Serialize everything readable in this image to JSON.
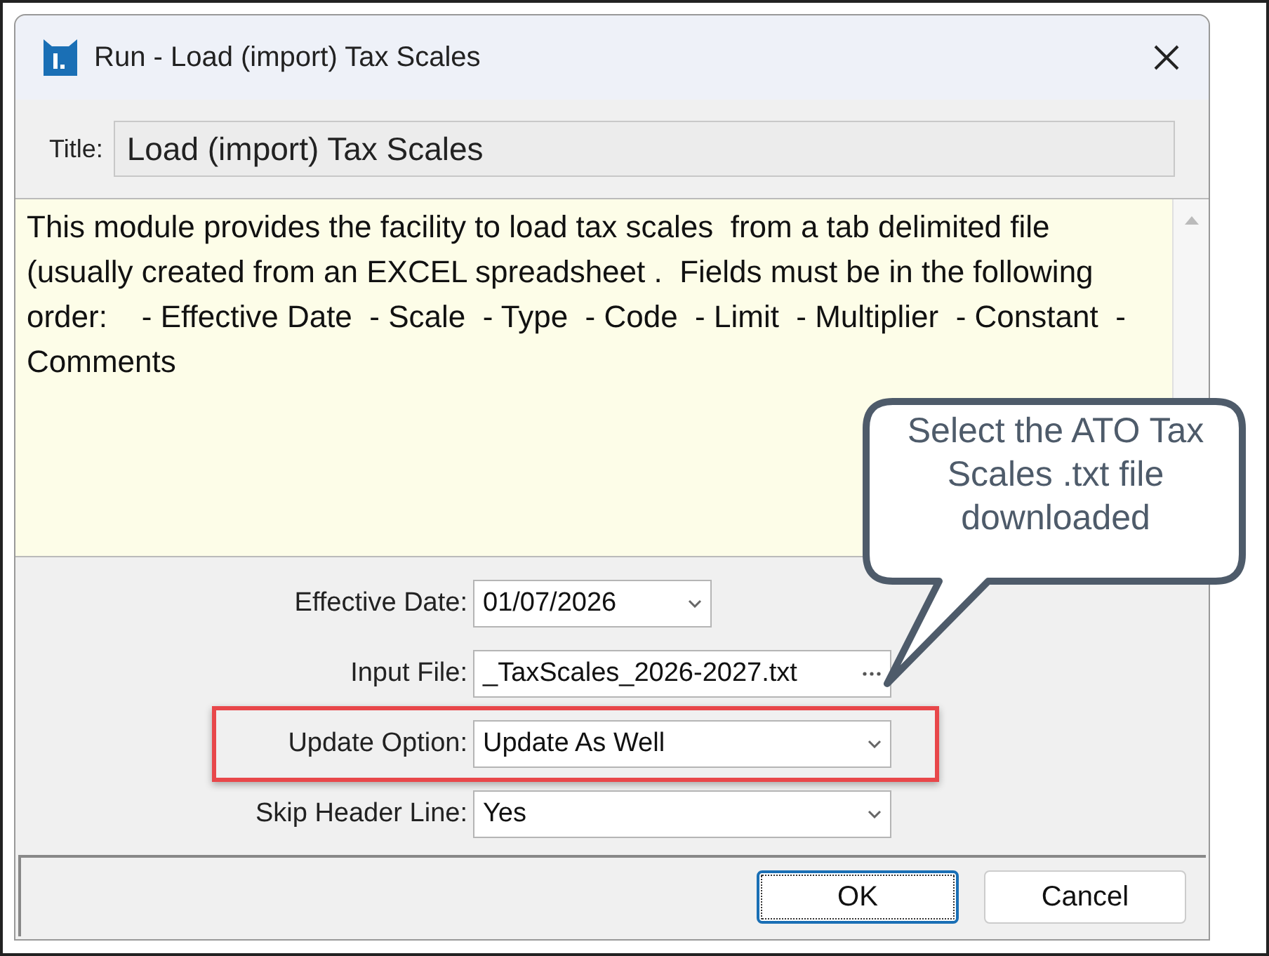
{
  "window": {
    "title": "Run - Load (import) Tax Scales"
  },
  "title_field": {
    "label": "Title:",
    "value": "Load (import) Tax Scales"
  },
  "description": "This module provides the facility to load tax scales  from a tab delimited file (usually created from an EXCEL spreadsheet .  Fields must be in the following order:    - Effective Date  - Scale  - Type  - Code  - Limit  - Multiplier  - Constant  - Comments",
  "fields": [
    {
      "label": "Effective Date:",
      "value": "01/07/2026",
      "kind": "dropdown",
      "highlighted": false
    },
    {
      "label": "Input File:",
      "value": "_TaxScales_2026-2027.txt",
      "kind": "file",
      "highlighted": false
    },
    {
      "label": "Update Option:",
      "value": "Update As Well",
      "kind": "dropdown",
      "highlighted": true
    },
    {
      "label": "Skip Header Line:",
      "value": "Yes",
      "kind": "dropdown",
      "highlighted": false
    }
  ],
  "callout": "Select the ATO Tax Scales .txt file downloaded",
  "buttons": [
    {
      "label": "OK",
      "selected": true
    },
    {
      "label": "Cancel",
      "selected": false
    }
  ]
}
